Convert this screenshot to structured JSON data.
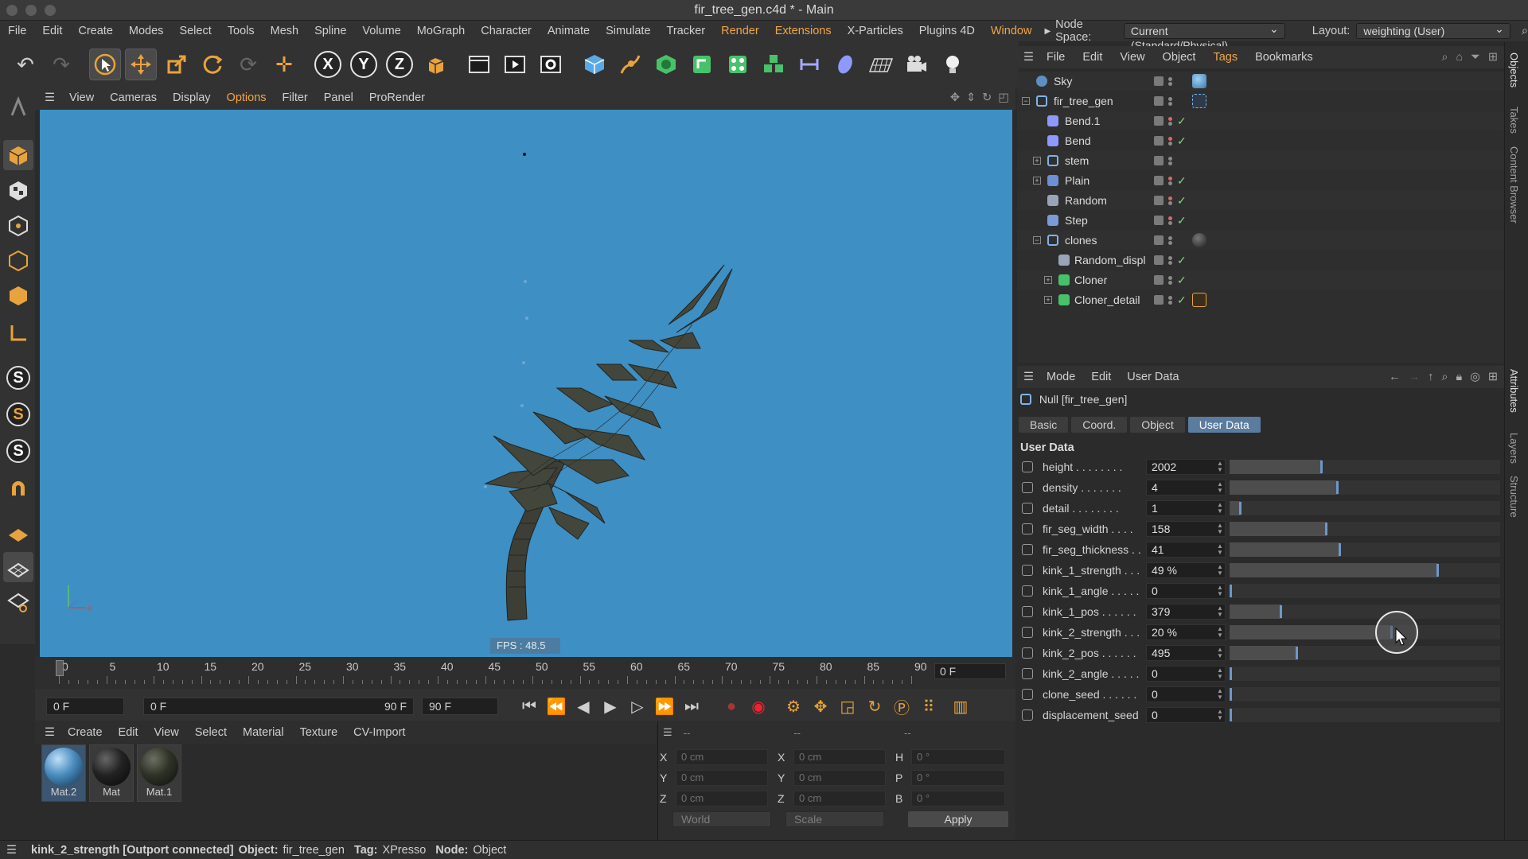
{
  "window": {
    "title": "fir_tree_gen.c4d * - Main"
  },
  "menubar": {
    "items": [
      "File",
      "Edit",
      "Create",
      "Modes",
      "Select",
      "Tools",
      "Mesh",
      "Spline",
      "Volume",
      "MoGraph",
      "Character",
      "Animate",
      "Simulate",
      "Tracker",
      "Render",
      "Extensions",
      "X-Particles",
      "Plugins 4D",
      "Window"
    ],
    "node_space_label": "Node Space:",
    "node_space_value": "Current (Standard/Physical)",
    "layout_label": "Layout:",
    "layout_value": "weighting (User)"
  },
  "viewport": {
    "menu": [
      "View",
      "Cameras",
      "Display",
      "Options",
      "Filter",
      "Panel",
      "ProRender"
    ],
    "fps": "FPS : 48.5",
    "background_color": "#3e8fc4"
  },
  "timeline": {
    "ticks": [
      "0",
      "5",
      "10",
      "15",
      "20",
      "25",
      "30",
      "35",
      "40",
      "45",
      "50",
      "55",
      "60",
      "65",
      "70",
      "75",
      "80",
      "85",
      "90"
    ],
    "current_frame": "0 F",
    "start_field": "0 F",
    "range_start": "0 F",
    "range_end": "90 F",
    "end_field": "90 F"
  },
  "materials": {
    "menu": [
      "Create",
      "Edit",
      "View",
      "Select",
      "Material",
      "Texture",
      "CV-Import"
    ],
    "items": [
      {
        "name": "Mat.2",
        "color": "#4a8cbf"
      },
      {
        "name": "Mat",
        "color": "#222222"
      },
      {
        "name": "Mat.1",
        "color": "#2e3327"
      }
    ]
  },
  "coords": {
    "header": [
      "--",
      "--",
      "--"
    ],
    "rows": [
      {
        "a1": "X",
        "v1": "0 cm",
        "a2": "X",
        "v2": "0 cm",
        "a3": "H",
        "v3": "0 °"
      },
      {
        "a1": "Y",
        "v1": "0 cm",
        "a2": "Y",
        "v2": "0 cm",
        "a3": "P",
        "v3": "0 °"
      },
      {
        "a1": "Z",
        "v1": "0 cm",
        "a2": "Z",
        "v2": "0 cm",
        "a3": "B",
        "v3": "0 °"
      }
    ],
    "space": "World",
    "mode": "Scale",
    "apply": "Apply"
  },
  "status": {
    "param": "kink_2_strength [Outport connected]",
    "object_label": "Object:",
    "object": "fir_tree_gen",
    "tag_label": "Tag:",
    "tag": "XPresso",
    "node_label": "Node:",
    "node": "Object"
  },
  "objects": {
    "menu": [
      "File",
      "Edit",
      "View",
      "Object",
      "Tags",
      "Bookmarks"
    ],
    "rows": [
      {
        "name": "Sky",
        "check": ""
      },
      {
        "name": "fir_tree_gen",
        "check": ""
      },
      {
        "name": "Bend.1",
        "check": "✓"
      },
      {
        "name": "Bend",
        "check": "✓"
      },
      {
        "name": "stem",
        "check": ""
      },
      {
        "name": "Plain",
        "check": "✓"
      },
      {
        "name": "Random",
        "check": "✓"
      },
      {
        "name": "Step",
        "check": "✓"
      },
      {
        "name": "clones",
        "check": ""
      },
      {
        "name": "Random_displ",
        "check": "✓"
      },
      {
        "name": "Cloner",
        "check": "✓"
      },
      {
        "name": "Cloner_detail",
        "check": "✓"
      }
    ]
  },
  "right_tabs": [
    "Objects",
    "Takes",
    "Content Browser",
    "Attributes",
    "Layers",
    "Structure"
  ],
  "attributes": {
    "menu": [
      "Mode",
      "Edit",
      "User Data"
    ],
    "title": "Null [fir_tree_gen]",
    "tabs": [
      "Basic",
      "Coord.",
      "Object",
      "User Data"
    ],
    "section": "User Data",
    "params": [
      {
        "label": "height . . . . . . . .",
        "value": "2002",
        "level": 0.34
      },
      {
        "label": "density . . . . . . .",
        "value": "4",
        "level": 0.4
      },
      {
        "label": "detail . . . . . . . .",
        "value": "1",
        "level": 0.04
      },
      {
        "label": "fir_seg_width . . . .",
        "value": "158",
        "level": 0.36
      },
      {
        "label": "fir_seg_thickness . .",
        "value": "41",
        "level": 0.41
      },
      {
        "label": "kink_1_strength . . .",
        "value": "49 %",
        "level": 0.77
      },
      {
        "label": "kink_1_angle . . . . .",
        "value": "0",
        "level": 0.0
      },
      {
        "label": "kink_1_pos . . . . . .",
        "value": "379",
        "level": 0.19
      },
      {
        "label": "kink_2_strength . . .",
        "value": "20 %",
        "level": 0.6
      },
      {
        "label": "kink_2_pos . . . . . .",
        "value": "495",
        "level": 0.25
      },
      {
        "label": "kink_2_angle . . . . .",
        "value": "0",
        "level": 0.0
      },
      {
        "label": "clone_seed . . . . . .",
        "value": "0",
        "level": 0.0
      },
      {
        "label": "displacement_seed",
        "value": "0",
        "level": 0.0
      }
    ]
  }
}
